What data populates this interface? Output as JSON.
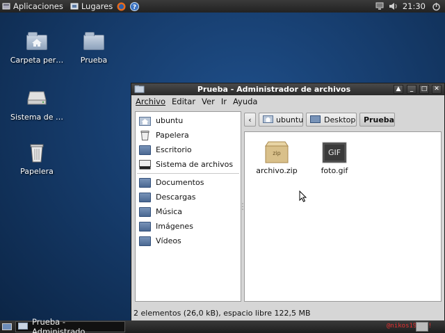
{
  "top_panel": {
    "applications": "Aplicaciones",
    "places": "Lugares",
    "clock": "21:30"
  },
  "desktop": {
    "icons": [
      {
        "label": "Carpeta per…",
        "icon": "home-folder-icon"
      },
      {
        "label": "Prueba",
        "icon": "folder-icon"
      },
      {
        "label": "Sistema de …",
        "icon": "drive-icon"
      },
      {
        "label": "Papelera",
        "icon": "trash-icon"
      }
    ]
  },
  "window": {
    "title": "Prueba - Administrador de archivos",
    "menu": [
      "Archivo",
      "Editar",
      "Ver",
      "Ir",
      "Ayuda"
    ],
    "sidebar": {
      "places": [
        "ubuntu",
        "Papelera",
        "Escritorio",
        "Sistema de archivos"
      ],
      "bookmarks": [
        "Documentos",
        "Descargas",
        "Música",
        "Imágenes",
        "Vídeos"
      ]
    },
    "pathbar": {
      "back": "‹",
      "segments": [
        "ubuntu",
        "Desktop",
        "Prueba"
      ]
    },
    "files": [
      {
        "name": "archivo.zip",
        "badge": "zip"
      },
      {
        "name": "foto.gif",
        "badge": "GIF"
      }
    ],
    "status": "2 elementos (26,0 kB), espacio libre 122,5 MB"
  },
  "bottom_panel": {
    "task": "Prueba - Administrado…",
    "tray_text": "@nikos198 T!"
  },
  "colors": {
    "desktop_blue": "#163c6c",
    "panel_dark": "#2a2a2a",
    "window_bg": "#d6d6d6"
  }
}
